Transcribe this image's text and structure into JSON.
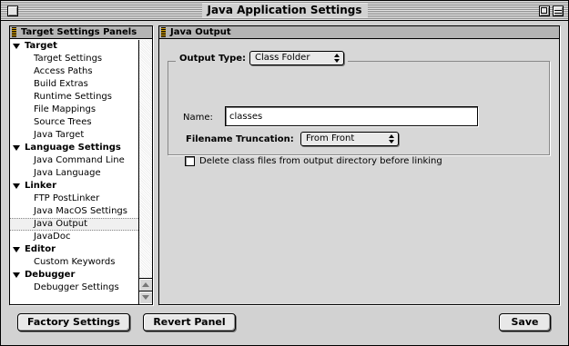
{
  "window": {
    "title": "Java Application Settings"
  },
  "left_panel": {
    "header": "Target Settings Panels",
    "tree": [
      {
        "label": "Target",
        "type": "group"
      },
      {
        "label": "Target Settings",
        "type": "child"
      },
      {
        "label": "Access Paths",
        "type": "child"
      },
      {
        "label": "Build Extras",
        "type": "child"
      },
      {
        "label": "Runtime Settings",
        "type": "child"
      },
      {
        "label": "File Mappings",
        "type": "child"
      },
      {
        "label": "Source Trees",
        "type": "child"
      },
      {
        "label": "Java Target",
        "type": "child"
      },
      {
        "label": "Language Settings",
        "type": "group"
      },
      {
        "label": "Java Command Line",
        "type": "child"
      },
      {
        "label": "Java Language",
        "type": "child"
      },
      {
        "label": "Linker",
        "type": "group"
      },
      {
        "label": "FTP PostLinker",
        "type": "child"
      },
      {
        "label": "Java MacOS Settings",
        "type": "child"
      },
      {
        "label": "Java Output",
        "type": "child",
        "selected": true
      },
      {
        "label": "JavaDoc",
        "type": "child"
      },
      {
        "label": "Editor",
        "type": "group"
      },
      {
        "label": "Custom Keywords",
        "type": "child"
      },
      {
        "label": "Debugger",
        "type": "group"
      },
      {
        "label": "Debugger Settings",
        "type": "child"
      }
    ]
  },
  "right_panel": {
    "header": "Java Output",
    "output_type_label": "Output Type:",
    "output_type_value": "Class Folder",
    "name_label": "Name:",
    "name_value": "classes",
    "truncation_label": "Filename Truncation:",
    "truncation_value": "From Front",
    "delete_checkbox_label": "Delete class files from output directory before linking",
    "delete_checkbox_checked": false
  },
  "buttons": {
    "factory": "Factory Settings",
    "revert": "Revert Panel",
    "save": "Save"
  }
}
